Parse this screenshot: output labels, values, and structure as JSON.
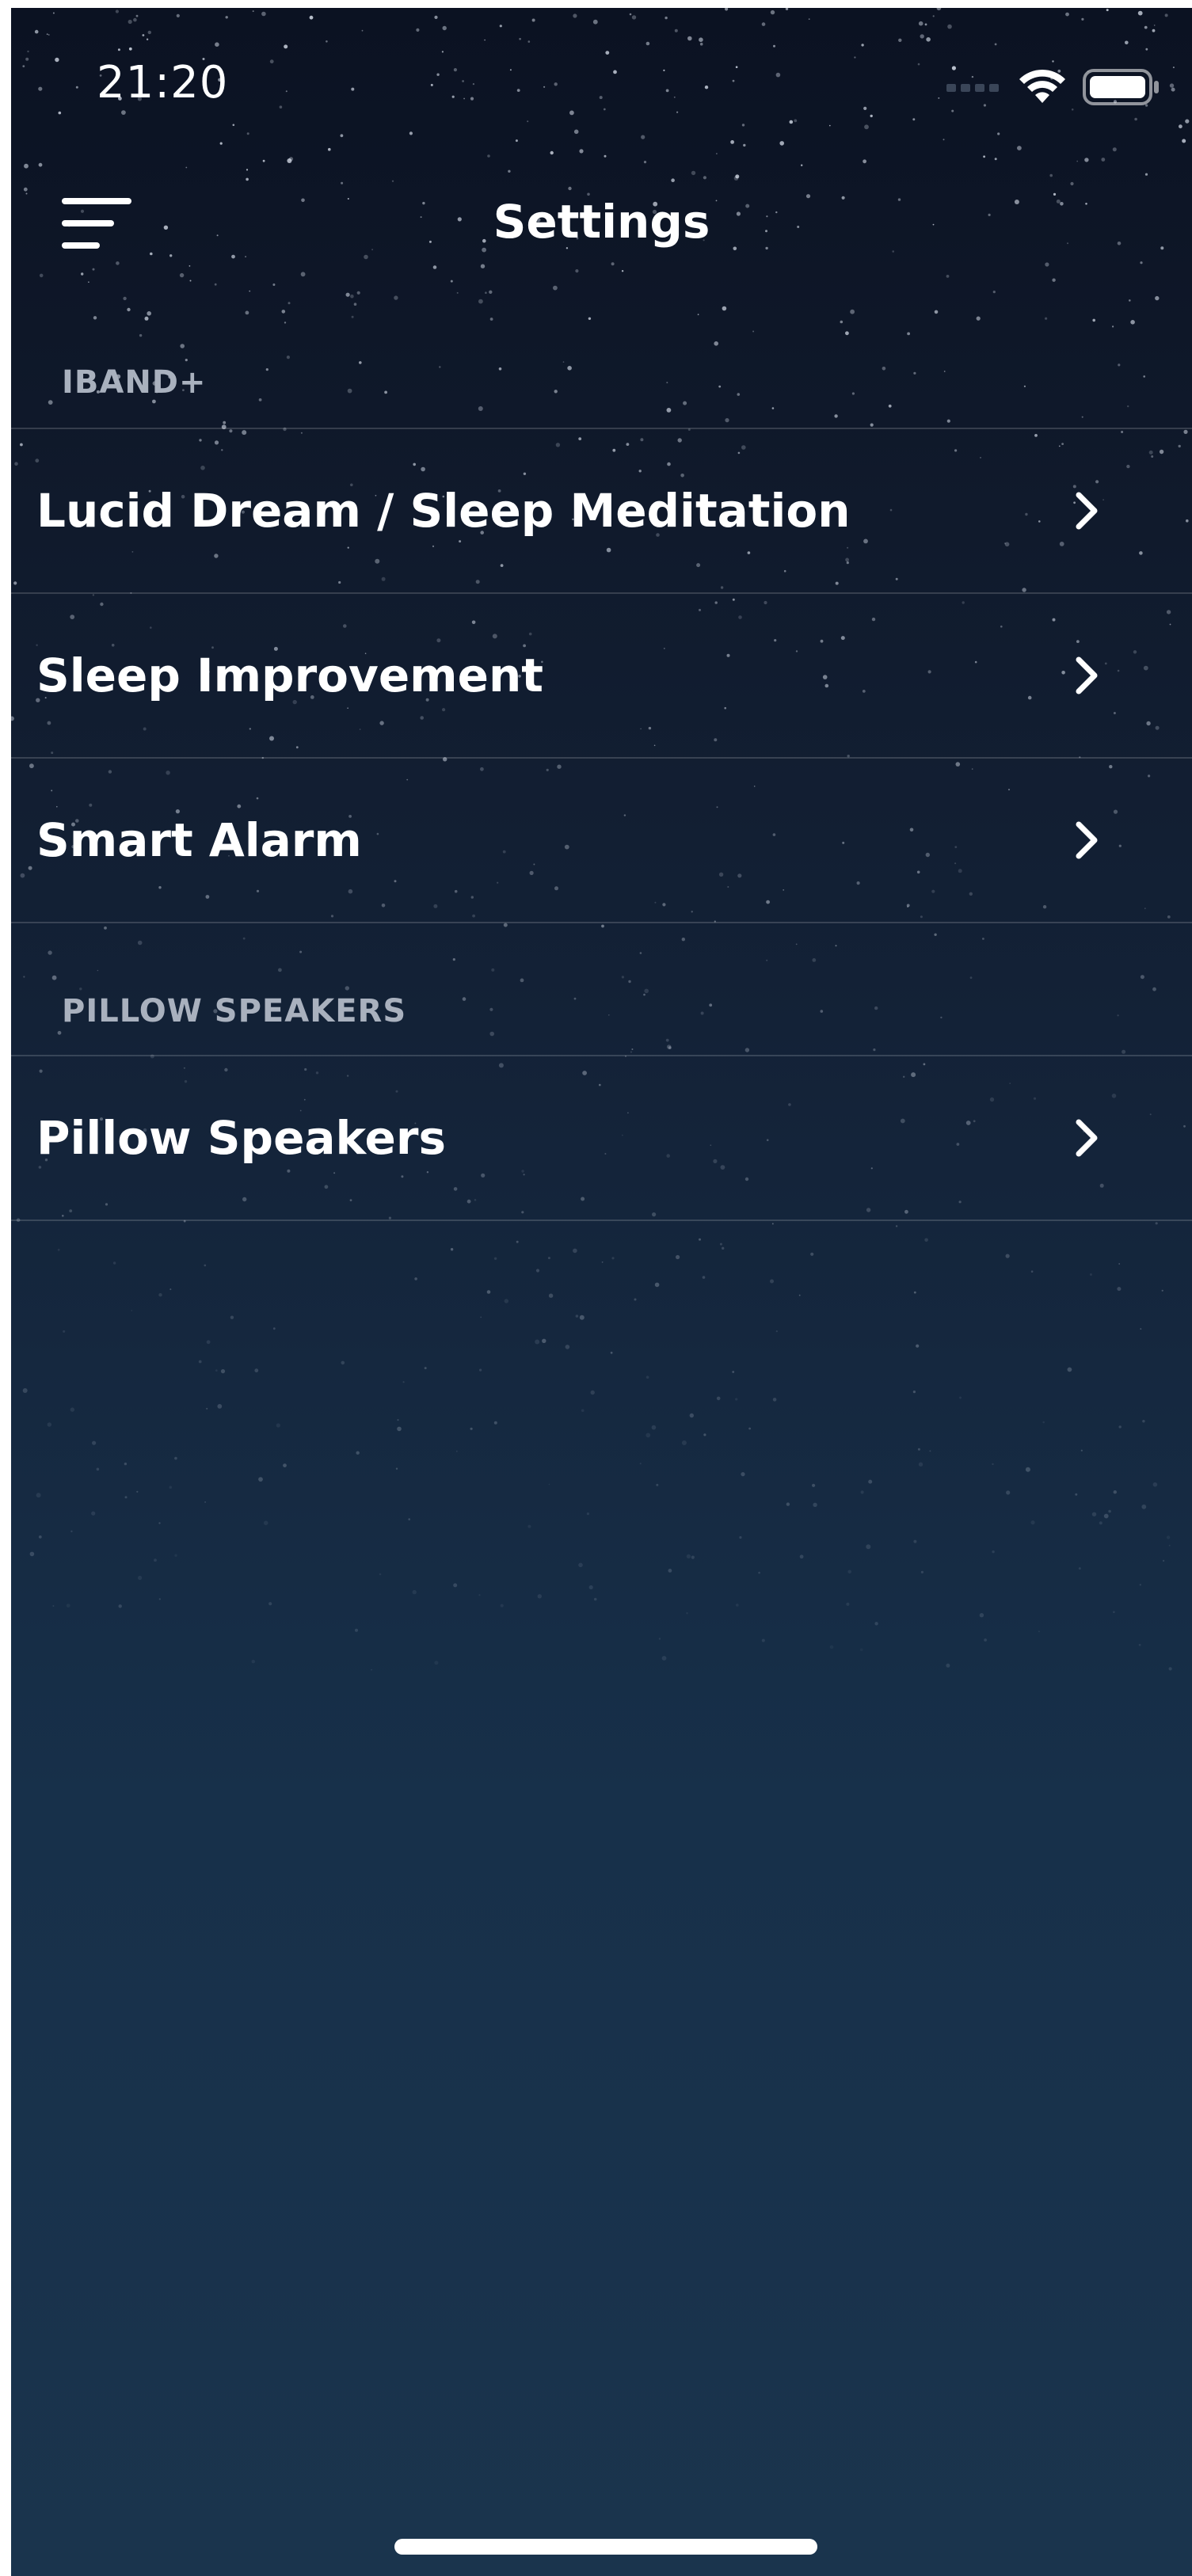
{
  "status_bar": {
    "time": "21:20",
    "icons": [
      "cellular-icon",
      "wifi-icon",
      "battery-icon"
    ]
  },
  "header": {
    "title": "Settings",
    "menu_icon": "menu-icon"
  },
  "sections": [
    {
      "header": "IBAND+",
      "items": [
        {
          "label": "Lucid Dream / Sleep Meditation",
          "icon": "chevron-right-icon"
        },
        {
          "label": "Sleep Improvement",
          "icon": "chevron-right-icon"
        },
        {
          "label": "Smart Alarm",
          "icon": "chevron-right-icon"
        }
      ]
    },
    {
      "header": "PILLOW SPEAKERS",
      "items": [
        {
          "label": "Pillow Speakers",
          "icon": "chevron-right-icon"
        }
      ]
    }
  ],
  "colors": {
    "background_top": "#0b1222",
    "background_bottom": "#1a344d",
    "section_header": "#a9b1be",
    "text": "#ffffff"
  }
}
